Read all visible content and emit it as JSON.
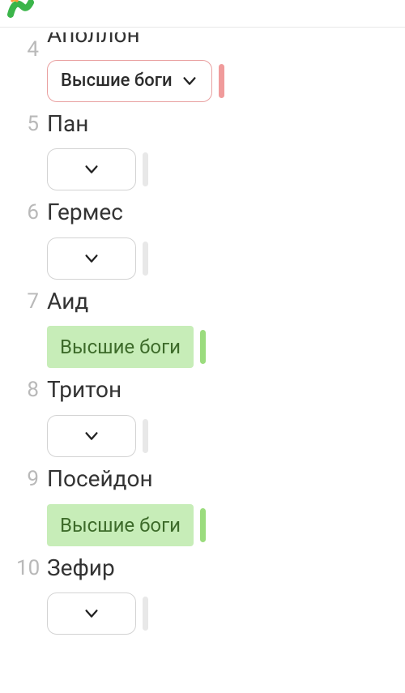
{
  "answer_label": "Высшие боги",
  "items": [
    {
      "num": "4",
      "name": "Аполлон",
      "state": "wrong"
    },
    {
      "num": "5",
      "name": "Пан",
      "state": "empty"
    },
    {
      "num": "6",
      "name": "Гермес",
      "state": "empty"
    },
    {
      "num": "7",
      "name": "Аид",
      "state": "correct"
    },
    {
      "num": "8",
      "name": "Тритон",
      "state": "empty"
    },
    {
      "num": "9",
      "name": "Посейдон",
      "state": "correct"
    },
    {
      "num": "10",
      "name": "Зефир",
      "state": "empty"
    }
  ]
}
